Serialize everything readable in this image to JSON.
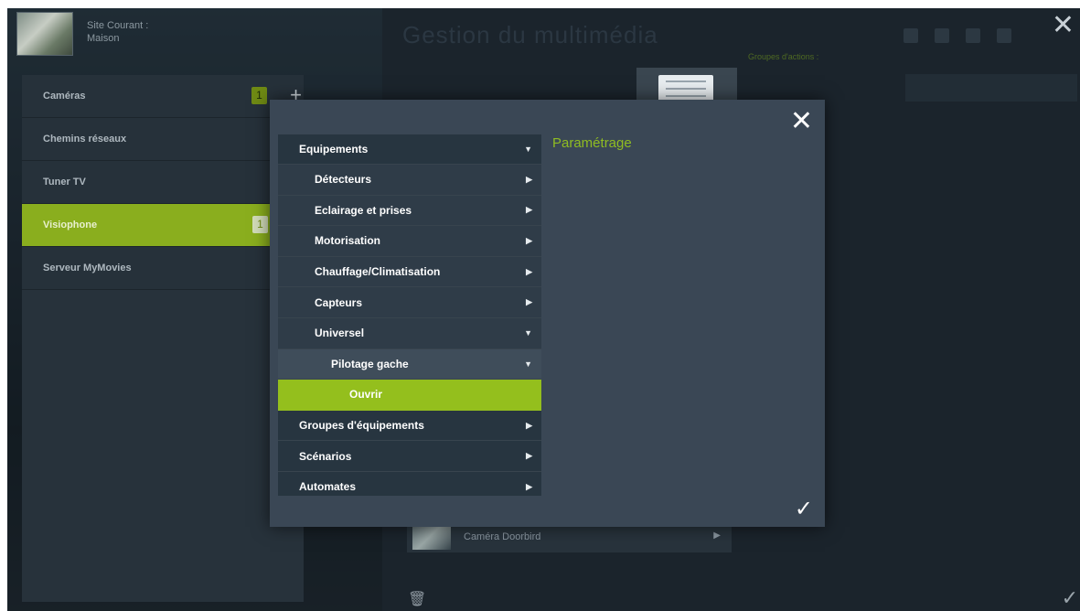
{
  "site": {
    "label_line1": "Site Courant :",
    "label_line2": "Maison"
  },
  "categories": [
    {
      "label": "Caméras",
      "badge": "1",
      "plus": "+"
    },
    {
      "label": "Chemins réseaux"
    },
    {
      "label": "Tuner TV"
    },
    {
      "label": "Visiophone",
      "badge": "1",
      "active": true
    },
    {
      "label": "Serveur MyMovies"
    }
  ],
  "background": {
    "title": "Gestion du multimédia",
    "groups_label": "Groupes d'actions :",
    "camera_label": "Caméra Doorbird",
    "close_glyph": "✕",
    "check_glyph": "✓",
    "trash_glyph": "🗑",
    "arrow_glyph": "▶"
  },
  "modal": {
    "close_glyph": "✕",
    "confirm_glyph": "✓",
    "param_title": "Paramétrage",
    "tree": [
      {
        "label": "Equipements",
        "arrow": "▼",
        "level": 0
      },
      {
        "label": "Détecteurs",
        "arrow": "▶",
        "level": 1
      },
      {
        "label": "Eclairage et prises",
        "arrow": "▶",
        "level": 1
      },
      {
        "label": "Motorisation",
        "arrow": "▶",
        "level": 1
      },
      {
        "label": "Chauffage/Climatisation",
        "arrow": "▶",
        "level": 1
      },
      {
        "label": "Capteurs",
        "arrow": "▶",
        "level": 1
      },
      {
        "label": "Universel",
        "arrow": "▼",
        "level": 1
      },
      {
        "label": "Pilotage gache",
        "arrow": "▼",
        "level": 2
      },
      {
        "label": "Ouvrir",
        "arrow": "",
        "level": 3
      },
      {
        "label": "Groupes d'équipements",
        "arrow": "▶",
        "level": 0
      },
      {
        "label": "Scénarios",
        "arrow": "▶",
        "level": 0
      },
      {
        "label": "Automates",
        "arrow": "▶",
        "level": 0
      }
    ]
  },
  "colors": {
    "accent": "#94bf1d",
    "panel": "#3a4755",
    "tree_bg": "#273540"
  }
}
